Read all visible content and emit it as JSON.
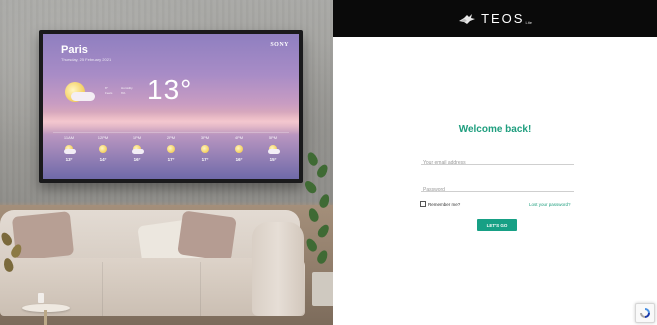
{
  "hero": {
    "tv": {
      "city": "Paris",
      "date": "Thursday, 25 February 2021",
      "brand": "SONY",
      "current_temp": "13°",
      "details": [
        "8°",
        "Feels",
        "Humidity",
        "6%"
      ],
      "hourly": [
        {
          "time": "11AM",
          "icon": "partly-cloudy-icon",
          "temp": "13°"
        },
        {
          "time": "12PM",
          "icon": "sun-icon",
          "temp": "14°"
        },
        {
          "time": "1PM",
          "icon": "partly-cloudy-icon",
          "temp": "16°"
        },
        {
          "time": "2PM",
          "icon": "sun-icon",
          "temp": "17°"
        },
        {
          "time": "3PM",
          "icon": "sun-icon",
          "temp": "17°"
        },
        {
          "time": "4PM",
          "icon": "sun-icon",
          "temp": "16°"
        },
        {
          "time": "5PM",
          "icon": "partly-cloudy-icon",
          "temp": "15°"
        }
      ]
    }
  },
  "header": {
    "logo_text": "TEOS",
    "logo_sub": "Lite"
  },
  "login": {
    "title": "Welcome back!",
    "email_placeholder": "Your email address",
    "password_placeholder": "Password",
    "remember_label": "Remember me?",
    "lost_password_label": "Lost your password?",
    "submit_label": "LET'S GO"
  },
  "colors": {
    "accent": "#1e9e7e",
    "button": "#17a085",
    "topbar": "#0a0a0a"
  }
}
